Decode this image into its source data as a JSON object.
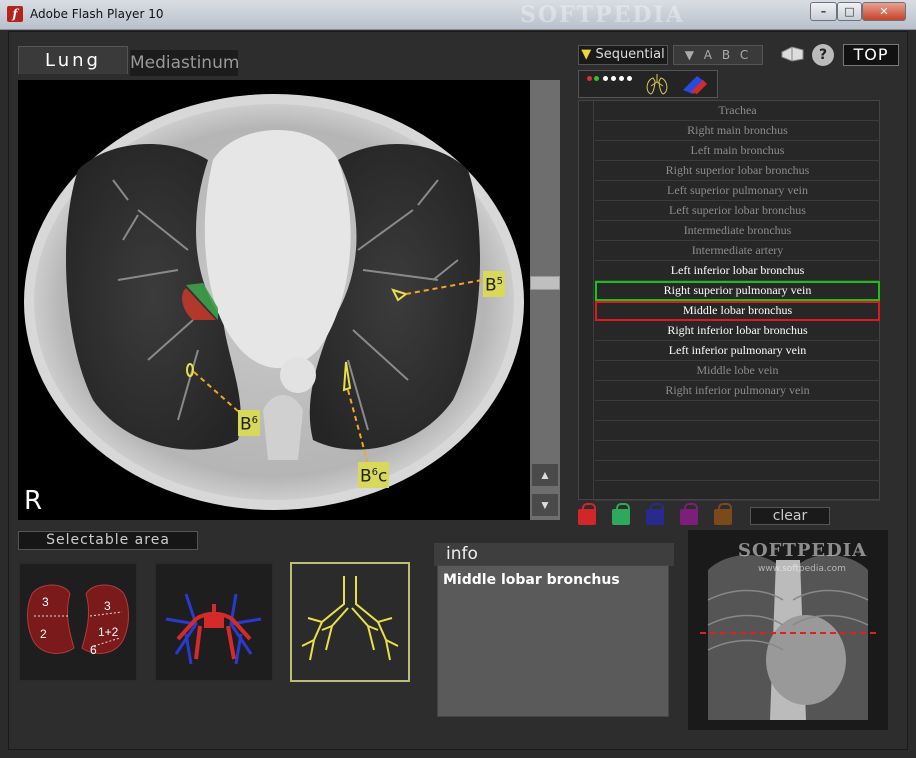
{
  "window": {
    "title": "Adobe Flash Player 10",
    "watermark": "SOFTPEDIA",
    "minimize": "–",
    "maximize": "□",
    "close": "✕"
  },
  "tabs": {
    "lung": "Lung",
    "mediastinum": "Mediastinum"
  },
  "viewer": {
    "side_label": "R",
    "labels": [
      {
        "base": "B",
        "sup": "5",
        "suffix": ""
      },
      {
        "base": "B",
        "sup": "6",
        "suffix": ""
      },
      {
        "base": "B",
        "sup": "6",
        "suffix": "c"
      }
    ]
  },
  "controls": {
    "sequential": "Sequential",
    "abc": "A B C",
    "help": "?",
    "top": "TOP",
    "clear": "clear"
  },
  "structures": [
    {
      "label": "Trachea",
      "state": "inactive"
    },
    {
      "label": "Right main bronchus",
      "state": "inactive"
    },
    {
      "label": "Left main bronchus",
      "state": "inactive"
    },
    {
      "label": "Right superior lobar bronchus",
      "state": "inactive"
    },
    {
      "label": "Left superior pulmonary vein",
      "state": "inactive"
    },
    {
      "label": "Left superior lobar bronchus",
      "state": "inactive"
    },
    {
      "label": "Intermediate bronchus",
      "state": "inactive"
    },
    {
      "label": "Intermediate artery",
      "state": "inactive"
    },
    {
      "label": "Left inferior lobar bronchus",
      "state": "active"
    },
    {
      "label": "Right superior pulmonary vein",
      "state": "active-green"
    },
    {
      "label": "Middle lobar bronchus",
      "state": "active-red"
    },
    {
      "label": "Right inferior lobar bronchus",
      "state": "active"
    },
    {
      "label": "Left inferior pulmonary vein",
      "state": "active"
    },
    {
      "label": "Middle lobe vein",
      "state": "inactive"
    },
    {
      "label": "Right inferior pulmonary vein",
      "state": "inactive"
    }
  ],
  "locks": [
    "#d02828",
    "#2ea85a",
    "#2a2a8c",
    "#7a1f7a",
    "#7a4a1a"
  ],
  "selectable": {
    "title": "Selectable area",
    "lobe_numbers": [
      "3",
      "3",
      "2",
      "1+2",
      "6"
    ]
  },
  "info": {
    "title": "info",
    "text": "Middle lobar bronchus"
  },
  "xray": {
    "watermark": "SOFTPEDIA",
    "url": "www.softpedia.com"
  }
}
